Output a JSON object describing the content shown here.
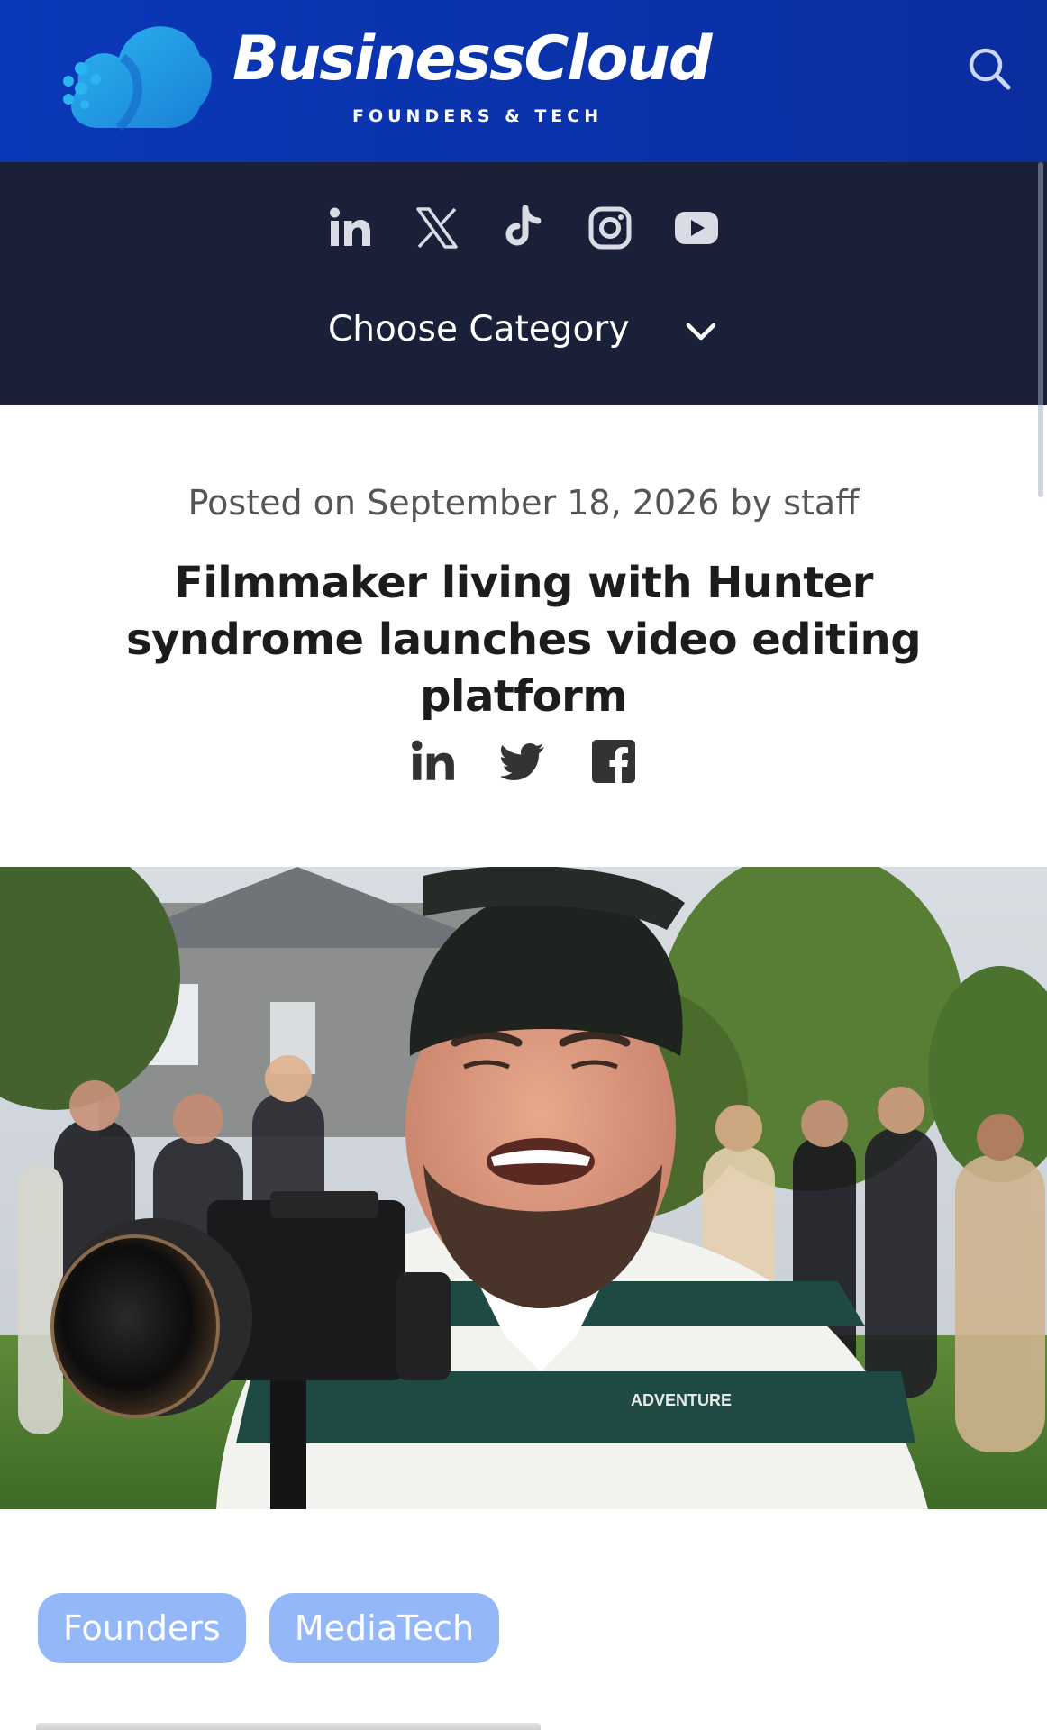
{
  "header": {
    "brand_name": "BusinessCloud",
    "brand_tagline": "FOUNDERS & TECH",
    "search_icon": "search-icon",
    "brand_colors": {
      "bar": "#0a33ad",
      "logo_cloud": "#1fa2e6"
    }
  },
  "nav": {
    "social_icons": [
      "linkedin-icon",
      "x-icon",
      "tiktok-icon",
      "instagram-icon",
      "youtube-icon"
    ],
    "category_label": "Choose Category",
    "category_icon": "chevron-down-icon",
    "background_color": "#1a2038"
  },
  "article": {
    "meta_prefix": "Posted on ",
    "meta_date": "September 18, 2026",
    "meta_by": " by ",
    "meta_author": "staff",
    "title": "Filmmaker living with Hunter syndrome launches video editing platform",
    "share_icons": [
      "linkedin-icon",
      "twitter-icon",
      "facebook-icon"
    ],
    "hero_image": {
      "shirt_text": "ADVENTURE",
      "description_icon": "photo"
    },
    "tags": [
      "Founders",
      "MediaTech"
    ],
    "tag_color": "#94b8f7"
  }
}
